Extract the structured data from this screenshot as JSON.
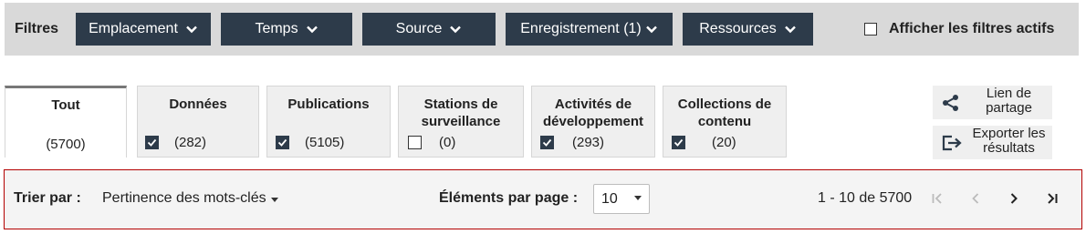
{
  "filters": {
    "label": "Filtres",
    "buttons": [
      {
        "label": "Emplacement"
      },
      {
        "label": "Temps"
      },
      {
        "label": "Source"
      },
      {
        "label": "Enregistrement (1)"
      },
      {
        "label": "Ressources"
      }
    ],
    "show_active": {
      "label": "Afficher les filtres actifs",
      "checked": false
    }
  },
  "tabs": [
    {
      "title": "Tout",
      "count": "(5700)",
      "active": true
    },
    {
      "title": "Données",
      "count": "(282)",
      "checked": true
    },
    {
      "title": "Publications",
      "count": "(5105)",
      "checked": true
    },
    {
      "title": "Stations de surveillance",
      "count": "(0)",
      "checked": false
    },
    {
      "title": "Activités de développement",
      "count": "(293)",
      "checked": true
    },
    {
      "title": "Collections de contenu",
      "count": "(20)",
      "checked": true
    }
  ],
  "actions": {
    "share": {
      "label": "Lien de partage",
      "icon": "share-icon"
    },
    "export": {
      "label": "Exporter les résultats",
      "icon": "export-icon"
    }
  },
  "sort": {
    "label": "Trier par :",
    "value": "Pertinence des mots-clés"
  },
  "per_page": {
    "label": "Éléments par page :",
    "value": "10"
  },
  "pagination": {
    "range": "1 - 10 de 5700",
    "first": "|<",
    "prev": "<",
    "next": ">",
    "last": ">|"
  },
  "colors": {
    "button_bg": "#2d3b4a",
    "filter_bar_bg": "#d9d9d9",
    "sort_bar_border": "#b30000"
  }
}
